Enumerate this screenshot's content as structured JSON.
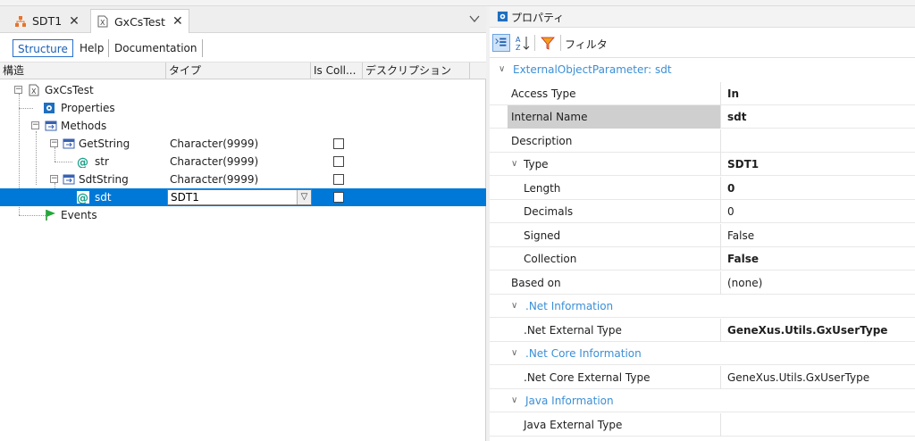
{
  "tabs": [
    {
      "label": "SDT1",
      "icon": "sdt-icon"
    },
    {
      "label": "GxCsTest",
      "icon": "external-object-icon"
    }
  ],
  "subtabs": [
    "Structure",
    "Help",
    "Documentation"
  ],
  "columns": [
    "構造",
    "タイプ",
    "Is Coll...",
    "デスクリプション"
  ],
  "tree": {
    "root": "GxCsTest",
    "properties": "Properties",
    "methods": "Methods",
    "getstring": {
      "label": "GetString",
      "type": "Character(9999)"
    },
    "str": {
      "label": "str",
      "type": "Character(9999)"
    },
    "sdtstring": {
      "label": "SdtString",
      "type": "Character(9999)"
    },
    "sdt": {
      "label": "sdt",
      "type": "SDT1"
    },
    "events": "Events"
  },
  "props": {
    "title": "プロパティ",
    "filter_label": "フィルタ",
    "category_header": "ExternalObjectParameter: sdt",
    "rows": [
      {
        "name": "Access Type",
        "value": "In"
      },
      {
        "name": "Internal Name",
        "value": "sdt"
      },
      {
        "name": "Description",
        "value": ""
      },
      {
        "name": "Type",
        "value": "SDT1"
      },
      {
        "name": "Length",
        "value": "0"
      },
      {
        "name": "Decimals",
        "value": "0"
      },
      {
        "name": "Signed",
        "value": "False"
      },
      {
        "name": "Collection",
        "value": "False"
      },
      {
        "name": "Based on",
        "value": "(none)"
      }
    ],
    "net_category": ".Net Information",
    "net_row": {
      "name": ".Net External Type",
      "value": "GeneXus.Utils.GxUserType"
    },
    "netcore_category": ".Net Core Information",
    "netcore_row": {
      "name": ".Net Core External Type",
      "value": "GeneXus.Utils.GxUserType"
    },
    "java_category": "Java Information",
    "java_row": {
      "name": "Java External Type",
      "value": ""
    }
  },
  "colors": {
    "selection": "#0078d7",
    "category": "#3c8fd6",
    "accent": "#1a5fb4"
  }
}
